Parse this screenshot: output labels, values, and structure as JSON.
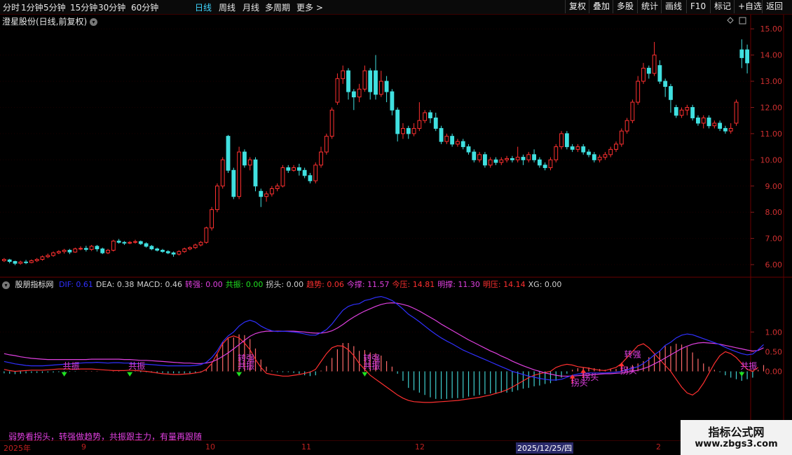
{
  "toolbar": {
    "tabs": [
      "分时",
      "1分钟",
      "5分钟",
      "15分钟",
      "30分钟",
      "60分钟",
      "日线",
      "周线",
      "月线",
      "多周期",
      "更多 >"
    ],
    "active_tab": "日线",
    "right_buttons": [
      "复权",
      "叠加",
      "多股",
      "统计",
      "画线",
      "F10",
      "标记",
      "+自选",
      "返回"
    ]
  },
  "main_chart": {
    "stock_title": "澄星股份(日线,前复权)",
    "price_ticks": [
      "15.00",
      "14.00",
      "13.00",
      "12.00",
      "11.00",
      "10.00",
      "9.00",
      "8.00",
      "7.00",
      "6.00"
    ]
  },
  "indicator": {
    "name": "股朋指标网",
    "items": [
      {
        "label": "DIF: 0.61",
        "color": "#3030ff"
      },
      {
        "label": "DEA: 0.38",
        "color": "#d0d0d0"
      },
      {
        "label": "MACD: 0.46",
        "color": "#d0d0d0"
      },
      {
        "label": "转强: 0.00",
        "color": "#e040e0"
      },
      {
        "label": "共振: 0.00",
        "color": "#20e020"
      },
      {
        "label": "拐头: 0.00",
        "color": "#d0d0d0"
      },
      {
        "label": "趋势: 0.06",
        "color": "#ff3030"
      },
      {
        "label": "今撑: 11.57",
        "color": "#e040e0"
      },
      {
        "label": "今压: 14.81",
        "color": "#ff3030"
      },
      {
        "label": "明撑: 11.30",
        "color": "#e040e0"
      },
      {
        "label": "明压: 14.14",
        "color": "#ff3030"
      },
      {
        "label": "XG: 0.00",
        "color": "#d0d0d0"
      }
    ],
    "y_ticks": [
      "1.00",
      "0.50",
      "0.00"
    ],
    "annotations": {
      "gongzhen": "共振",
      "zhuanqiang": "转强",
      "guaitou": "拐头"
    },
    "tagline": "弱势看拐头，转强做趋势，共振跟主力，有量再跟随"
  },
  "time_axis": {
    "labels": [
      "2025年",
      "9",
      "10",
      "11",
      "12",
      "2025/12/25/四",
      "2"
    ],
    "highlight": "2025/12/25/四"
  },
  "watermark": {
    "title": "指标公式网",
    "url": "www.zbgs3.com"
  },
  "colors": {
    "up": "#ff3030",
    "down": "#40e0e0",
    "dif": "#3030ff",
    "dea": "#e040e0",
    "trend": "#ff3030"
  },
  "chart_data": {
    "type": "candlestick",
    "ylim": [
      5.6,
      15.3
    ],
    "candles": [
      [
        6.15,
        6.2,
        6.25,
        6.1
      ],
      [
        6.18,
        6.12,
        6.22,
        6.05
      ],
      [
        6.12,
        6.05,
        6.15,
        5.98
      ],
      [
        6.05,
        6.1,
        6.15,
        6.0
      ],
      [
        6.1,
        6.08,
        6.18,
        6.02
      ],
      [
        6.08,
        6.15,
        6.2,
        6.05
      ],
      [
        6.15,
        6.2,
        6.25,
        6.1
      ],
      [
        6.2,
        6.3,
        6.35,
        6.15
      ],
      [
        6.3,
        6.35,
        6.42,
        6.25
      ],
      [
        6.35,
        6.45,
        6.5,
        6.3
      ],
      [
        6.45,
        6.5,
        6.55,
        6.4
      ],
      [
        6.5,
        6.55,
        6.6,
        6.42
      ],
      [
        6.55,
        6.48,
        6.6,
        6.4
      ],
      [
        6.48,
        6.6,
        6.65,
        6.45
      ],
      [
        6.6,
        6.62,
        6.7,
        6.55
      ],
      [
        6.62,
        6.58,
        6.72,
        6.5
      ],
      [
        6.58,
        6.7,
        6.75,
        6.52
      ],
      [
        6.7,
        6.6,
        6.75,
        6.5
      ],
      [
        6.6,
        6.45,
        6.65,
        6.4
      ],
      [
        6.45,
        6.55,
        6.6,
        6.4
      ],
      [
        6.55,
        6.9,
        6.95,
        6.5
      ],
      [
        6.9,
        6.85,
        6.98,
        6.8
      ],
      [
        6.85,
        6.82,
        6.9,
        6.75
      ],
      [
        6.82,
        6.85,
        6.9,
        6.78
      ],
      [
        6.85,
        6.88,
        6.95,
        6.8
      ],
      [
        6.88,
        6.8,
        6.92,
        6.75
      ],
      [
        6.8,
        6.7,
        6.85,
        6.65
      ],
      [
        6.7,
        6.6,
        6.75,
        6.55
      ],
      [
        6.6,
        6.55,
        6.65,
        6.5
      ],
      [
        6.55,
        6.5,
        6.6,
        6.45
      ],
      [
        6.5,
        6.45,
        6.55,
        6.4
      ],
      [
        6.45,
        6.4,
        6.5,
        6.3
      ],
      [
        6.4,
        6.5,
        6.55,
        6.35
      ],
      [
        6.5,
        6.6,
        6.65,
        6.45
      ],
      [
        6.6,
        6.65,
        6.7,
        6.55
      ],
      [
        6.65,
        6.75,
        6.8,
        6.6
      ],
      [
        6.75,
        6.85,
        6.9,
        6.7
      ],
      [
        6.85,
        7.4,
        7.45,
        6.8
      ],
      [
        7.4,
        8.1,
        8.2,
        7.3
      ],
      [
        8.1,
        9.0,
        9.1,
        8.0
      ],
      [
        9.0,
        10.0,
        10.1,
        8.9
      ],
      [
        10.9,
        9.6,
        10.95,
        9.5
      ],
      [
        9.6,
        8.6,
        9.7,
        8.5
      ],
      [
        8.6,
        10.3,
        10.5,
        8.5
      ],
      [
        10.3,
        9.8,
        10.4,
        9.7
      ],
      [
        9.8,
        10.0,
        10.1,
        9.6
      ],
      [
        10.0,
        9.0,
        10.1,
        8.8
      ],
      [
        8.8,
        8.6,
        8.9,
        8.2
      ],
      [
        8.6,
        8.7,
        8.8,
        8.4
      ],
      [
        8.7,
        8.9,
        9.0,
        8.6
      ],
      [
        8.9,
        9.0,
        9.1,
        8.8
      ],
      [
        9.0,
        9.7,
        9.8,
        8.95
      ],
      [
        9.7,
        9.6,
        9.8,
        9.5
      ],
      [
        9.6,
        9.7,
        9.8,
        9.55
      ],
      [
        9.7,
        9.6,
        9.85,
        9.4
      ],
      [
        9.6,
        9.4,
        9.7,
        9.3
      ],
      [
        9.4,
        9.2,
        9.5,
        9.1
      ],
      [
        9.2,
        9.8,
        9.9,
        9.1
      ],
      [
        9.8,
        10.3,
        10.5,
        9.7
      ],
      [
        10.3,
        10.9,
        11.0,
        10.2
      ],
      [
        10.9,
        11.9,
        12.0,
        10.8
      ],
      [
        12.2,
        13.1,
        13.3,
        12.1
      ],
      [
        13.1,
        13.4,
        13.6,
        12.9
      ],
      [
        13.4,
        12.6,
        13.5,
        12.3
      ],
      [
        12.6,
        12.4,
        12.7,
        11.9
      ],
      [
        12.4,
        12.7,
        12.9,
        12.2
      ],
      [
        12.7,
        13.4,
        13.6,
        12.6
      ],
      [
        13.4,
        12.6,
        13.5,
        12.3
      ],
      [
        13.4,
        12.5,
        14.0,
        12.3
      ],
      [
        12.5,
        13.0,
        13.4,
        12.4
      ],
      [
        13.0,
        12.6,
        13.2,
        12.2
      ],
      [
        12.6,
        11.9,
        12.7,
        11.7
      ],
      [
        11.9,
        11.0,
        12.0,
        10.7
      ],
      [
        11.0,
        11.2,
        11.4,
        10.8
      ],
      [
        11.2,
        11.0,
        11.3,
        10.8
      ],
      [
        11.0,
        11.2,
        11.4,
        10.9
      ],
      [
        11.2,
        11.5,
        12.2,
        11.1
      ],
      [
        11.5,
        11.8,
        11.9,
        11.4
      ],
      [
        11.8,
        11.6,
        11.9,
        11.4
      ],
      [
        11.6,
        11.2,
        11.8,
        11.1
      ],
      [
        11.2,
        10.7,
        11.3,
        10.6
      ],
      [
        10.7,
        10.9,
        11.0,
        10.6
      ],
      [
        10.9,
        10.6,
        11.0,
        10.5
      ],
      [
        10.6,
        10.7,
        10.8,
        10.5
      ],
      [
        10.7,
        10.5,
        10.8,
        10.4
      ],
      [
        10.5,
        10.3,
        10.6,
        10.2
      ],
      [
        10.3,
        10.0,
        10.4,
        9.9
      ],
      [
        10.0,
        10.2,
        10.3,
        9.9
      ],
      [
        10.2,
        9.8,
        10.3,
        9.7
      ],
      [
        9.8,
        10.0,
        10.1,
        9.7
      ],
      [
        10.0,
        9.9,
        10.1,
        9.8
      ],
      [
        9.9,
        10.0,
        10.1,
        9.8
      ],
      [
        10.0,
        10.05,
        10.15,
        9.9
      ],
      [
        10.05,
        10.0,
        10.15,
        9.9
      ],
      [
        10.0,
        10.1,
        10.5,
        9.9
      ],
      [
        10.1,
        10.0,
        10.2,
        9.8
      ],
      [
        10.0,
        10.2,
        10.3,
        9.9
      ],
      [
        10.2,
        10.0,
        10.4,
        9.9
      ],
      [
        10.0,
        9.8,
        10.1,
        9.7
      ],
      [
        9.8,
        9.7,
        9.9,
        9.6
      ],
      [
        9.7,
        10.0,
        10.1,
        9.6
      ],
      [
        10.0,
        10.5,
        10.6,
        9.9
      ],
      [
        10.5,
        11.0,
        11.1,
        10.4
      ],
      [
        11.0,
        10.5,
        11.1,
        10.4
      ],
      [
        10.5,
        10.4,
        10.6,
        10.3
      ],
      [
        10.4,
        10.5,
        10.6,
        10.3
      ],
      [
        10.5,
        10.3,
        10.6,
        10.2
      ],
      [
        10.3,
        10.2,
        10.4,
        10.1
      ],
      [
        10.2,
        10.0,
        10.3,
        9.9
      ],
      [
        10.0,
        10.1,
        10.2,
        9.9
      ],
      [
        10.1,
        10.2,
        10.3,
        10.0
      ],
      [
        10.2,
        10.4,
        10.5,
        10.1
      ],
      [
        10.4,
        10.6,
        10.7,
        10.3
      ],
      [
        10.6,
        11.1,
        11.2,
        10.5
      ],
      [
        11.1,
        11.5,
        11.6,
        11.0
      ],
      [
        11.5,
        12.2,
        12.3,
        11.4
      ],
      [
        12.2,
        13.0,
        13.2,
        12.1
      ],
      [
        13.0,
        13.5,
        13.7,
        12.9
      ],
      [
        13.5,
        13.3,
        13.6,
        13.1
      ],
      [
        13.3,
        14.0,
        14.5,
        13.2
      ],
      [
        13.6,
        13.0,
        13.8,
        12.9
      ],
      [
        13.0,
        12.8,
        13.1,
        12.4
      ],
      [
        12.8,
        12.3,
        12.9,
        11.8
      ],
      [
        12.0,
        11.7,
        12.1,
        11.6
      ],
      [
        11.7,
        11.9,
        12.0,
        11.6
      ],
      [
        11.9,
        12.0,
        12.1,
        11.7
      ],
      [
        12.0,
        11.6,
        12.1,
        11.5
      ],
      [
        11.6,
        11.4,
        11.7,
        11.3
      ],
      [
        11.4,
        11.6,
        11.7,
        11.2
      ],
      [
        11.6,
        11.3,
        11.7,
        11.2
      ],
      [
        11.3,
        11.4,
        11.5,
        11.2
      ],
      [
        11.4,
        11.2,
        11.5,
        11.1
      ],
      [
        11.2,
        11.1,
        11.3,
        11.0
      ],
      [
        11.1,
        11.2,
        11.4,
        11.0
      ],
      [
        11.4,
        12.2,
        12.3,
        11.3
      ],
      [
        14.2,
        13.9,
        14.6,
        13.5
      ],
      [
        14.2,
        13.7,
        14.4,
        13.3
      ]
    ],
    "macd": {
      "ylim": [
        -1.2,
        2.0
      ],
      "dif": [
        0.25,
        0.22,
        0.19,
        0.17,
        0.15,
        0.14,
        0.14,
        0.14,
        0.15,
        0.16,
        0.17,
        0.18,
        0.19,
        0.2,
        0.21,
        0.22,
        0.22,
        0.23,
        0.22,
        0.21,
        0.22,
        0.22,
        0.21,
        0.21,
        0.2,
        0.19,
        0.18,
        0.17,
        0.16,
        0.15,
        0.14,
        0.14,
        0.14,
        0.14,
        0.14,
        0.15,
        0.17,
        0.23,
        0.35,
        0.52,
        0.75,
        0.9,
        1.0,
        1.15,
        1.25,
        1.3,
        1.25,
        1.15,
        1.08,
        1.03,
        1.01,
        1.02,
        1.01,
        1.0,
        0.98,
        0.95,
        0.92,
        0.92,
        0.98,
        1.06,
        1.2,
        1.38,
        1.55,
        1.65,
        1.7,
        1.72,
        1.8,
        1.83,
        1.88,
        1.9,
        1.86,
        1.8,
        1.7,
        1.58,
        1.45,
        1.36,
        1.26,
        1.15,
        1.04,
        0.94,
        0.85,
        0.77,
        0.7,
        0.62,
        0.54,
        0.48,
        0.42,
        0.36,
        0.3,
        0.24,
        0.18,
        0.12,
        0.06,
        0.0,
        -0.04,
        -0.08,
        -0.12,
        -0.15,
        -0.18,
        -0.2,
        -0.22,
        -0.22,
        -0.2,
        -0.15,
        -0.1,
        -0.07,
        -0.05,
        -0.04,
        -0.04,
        -0.04,
        -0.04,
        -0.03,
        -0.02,
        0.0,
        0.04,
        0.08,
        0.12,
        0.2,
        0.3,
        0.42,
        0.52,
        0.66,
        0.74,
        0.85,
        0.92,
        0.95,
        0.93,
        0.88,
        0.83,
        0.78,
        0.73,
        0.68,
        0.61,
        0.55,
        0.5,
        0.45,
        0.42,
        0.44,
        0.55,
        0.68
      ],
      "dea": [
        0.45,
        0.42,
        0.4,
        0.37,
        0.35,
        0.33,
        0.32,
        0.31,
        0.3,
        0.3,
        0.3,
        0.3,
        0.3,
        0.3,
        0.3,
        0.3,
        0.31,
        0.31,
        0.31,
        0.31,
        0.31,
        0.31,
        0.3,
        0.3,
        0.29,
        0.28,
        0.28,
        0.27,
        0.26,
        0.25,
        0.24,
        0.23,
        0.22,
        0.21,
        0.21,
        0.2,
        0.2,
        0.21,
        0.24,
        0.3,
        0.38,
        0.47,
        0.57,
        0.68,
        0.79,
        0.89,
        0.96,
        1.0,
        1.02,
        1.02,
        1.02,
        1.02,
        1.02,
        1.02,
        1.01,
        1.0,
        0.98,
        0.97,
        0.97,
        0.99,
        1.03,
        1.1,
        1.19,
        1.29,
        1.38,
        1.46,
        1.53,
        1.59,
        1.65,
        1.7,
        1.73,
        1.74,
        1.73,
        1.7,
        1.66,
        1.6,
        1.53,
        1.45,
        1.37,
        1.29,
        1.2,
        1.12,
        1.04,
        0.96,
        0.88,
        0.8,
        0.73,
        0.66,
        0.59,
        0.52,
        0.46,
        0.39,
        0.33,
        0.26,
        0.2,
        0.14,
        0.09,
        0.04,
        0.0,
        -0.04,
        -0.07,
        -0.1,
        -0.12,
        -0.12,
        -0.12,
        -0.11,
        -0.1,
        -0.09,
        -0.08,
        -0.07,
        -0.06,
        -0.06,
        -0.05,
        -0.04,
        -0.02,
        0.0,
        0.03,
        0.07,
        0.12,
        0.19,
        0.26,
        0.34,
        0.42,
        0.5,
        0.58,
        0.64,
        0.69,
        0.72,
        0.73,
        0.72,
        0.71,
        0.69,
        0.66,
        0.63,
        0.6,
        0.57,
        0.54,
        0.52,
        0.53,
        0.6
      ],
      "trend": [
        0.05,
        0.02,
        0.0,
        0.01,
        0.02,
        0.03,
        0.03,
        0.03,
        0.04,
        0.05,
        0.06,
        0.06,
        0.06,
        0.05,
        0.06,
        0.06,
        0.06,
        0.05,
        0.04,
        0.03,
        0.02,
        0.02,
        0.02,
        0.03,
        0.02,
        0.01,
        0.0,
        -0.02,
        -0.04,
        -0.06,
        -0.07,
        -0.08,
        -0.08,
        -0.07,
        -0.06,
        -0.04,
        -0.02,
        0.05,
        0.2,
        0.45,
        0.7,
        0.85,
        0.9,
        0.85,
        0.72,
        0.55,
        0.3,
        0.1,
        -0.05,
        -0.08,
        -0.1,
        -0.12,
        -0.12,
        -0.1,
        -0.08,
        -0.05,
        -0.02,
        0.05,
        0.25,
        0.45,
        0.6,
        0.65,
        0.64,
        0.55,
        0.4,
        0.2,
        0.05,
        -0.1,
        -0.2,
        -0.3,
        -0.4,
        -0.5,
        -0.6,
        -0.68,
        -0.74,
        -0.77,
        -0.78,
        -0.79,
        -0.79,
        -0.78,
        -0.77,
        -0.76,
        -0.75,
        -0.74,
        -0.72,
        -0.7,
        -0.68,
        -0.66,
        -0.63,
        -0.6,
        -0.56,
        -0.52,
        -0.47,
        -0.4,
        -0.32,
        -0.24,
        -0.16,
        -0.1,
        -0.06,
        -0.03,
        0.0,
        0.1,
        0.15,
        0.18,
        0.16,
        0.12,
        0.1,
        0.08,
        0.05,
        0.03,
        0.02,
        0.06,
        0.1,
        0.2,
        0.35,
        0.5,
        0.65,
        0.7,
        0.6,
        0.45,
        0.3,
        0.15,
        0.0,
        -0.2,
        -0.4,
        -0.55,
        -0.6,
        -0.5,
        -0.3,
        -0.05,
        0.2,
        0.4,
        0.5,
        0.45,
        0.35,
        0.2,
        0.05,
        0.0,
        0.1
      ],
      "bars": [
        -0.05,
        -0.06,
        -0.07,
        -0.06,
        -0.05,
        -0.04,
        -0.04,
        -0.04,
        -0.03,
        -0.03,
        -0.02,
        -0.02,
        -0.01,
        -0.01,
        0.0,
        0.01,
        0.01,
        0.01,
        0.0,
        0.0,
        0.01,
        0.01,
        0.0,
        0.0,
        -0.01,
        -0.02,
        -0.02,
        -0.03,
        -0.04,
        -0.04,
        -0.05,
        -0.05,
        -0.05,
        -0.05,
        -0.05,
        -0.04,
        -0.03,
        0.04,
        0.2,
        0.44,
        0.74,
        0.86,
        0.86,
        0.94,
        0.92,
        0.82,
        0.58,
        0.3,
        0.12,
        0.02,
        -0.02,
        -0.02,
        -0.02,
        -0.04,
        -0.06,
        -0.1,
        -0.12,
        -0.1,
        0.02,
        0.14,
        0.34,
        0.56,
        0.72,
        0.72,
        0.64,
        0.52,
        0.54,
        0.48,
        0.46,
        0.4,
        0.26,
        0.12,
        -0.06,
        -0.24,
        -0.42,
        -0.48,
        -0.54,
        -0.6,
        -0.66,
        -0.7,
        -0.7,
        -0.7,
        -0.68,
        -0.68,
        -0.68,
        -0.64,
        -0.62,
        -0.6,
        -0.58,
        -0.56,
        -0.56,
        -0.54,
        -0.54,
        -0.52,
        -0.48,
        -0.44,
        -0.42,
        -0.38,
        -0.36,
        -0.32,
        -0.3,
        -0.24,
        -0.16,
        -0.06,
        0.04,
        0.08,
        0.1,
        0.1,
        0.08,
        0.06,
        0.04,
        0.06,
        0.06,
        0.08,
        0.12,
        0.16,
        0.2,
        0.26,
        0.36,
        0.46,
        0.52,
        0.64,
        0.64,
        0.7,
        0.68,
        0.62,
        0.48,
        0.32,
        0.2,
        0.12,
        0.04,
        -0.02,
        -0.1,
        -0.16,
        -0.2,
        -0.24,
        -0.2,
        -0.16,
        0.04,
        0.16
      ]
    }
  }
}
